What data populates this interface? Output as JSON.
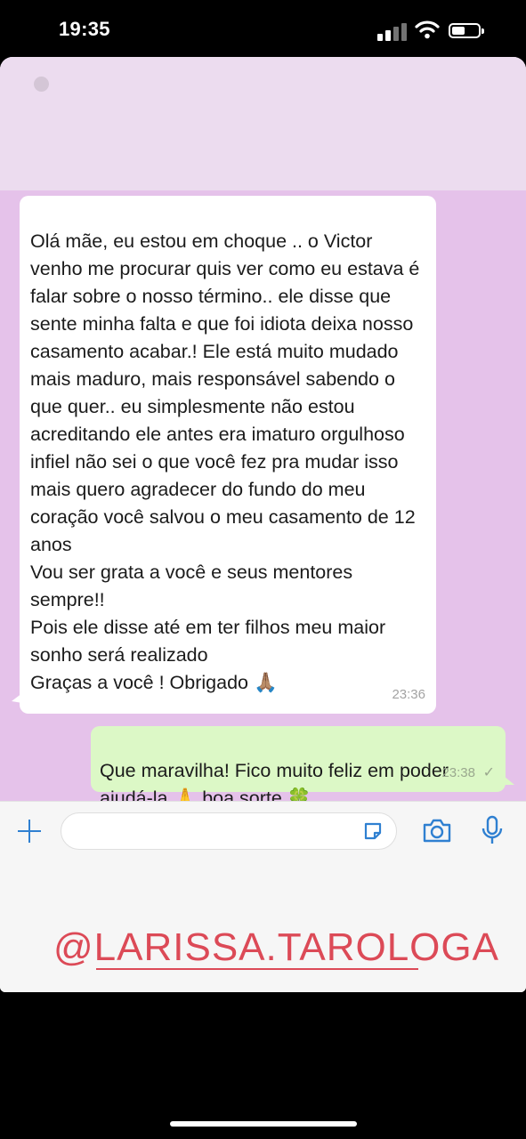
{
  "status_bar": {
    "time": "19:35",
    "icons": [
      "cellular-signal-icon",
      "wifi-icon",
      "battery-icon"
    ]
  },
  "chat": {
    "incoming_message": {
      "text": "Olá mãe, eu estou em choque .. o Victor venho me procurar quis ver como eu estava é falar sobre o nosso término.. ele disse que sente minha falta e que foi idiota deixa nosso casamento acabar.! Ele está muito mudado mais maduro, mais responsável sabendo o que quer.. eu simplesmente não estou acreditando ele antes era imaturo orgulhoso infiel não sei o que você fez pra mudar isso mais quero agradecer do fundo do meu coração você salvou o meu casamento de 12 anos\nVou ser grata a você e seus mentores sempre!!\nPois ele disse até em ter filhos meu maior sonho será realizado\nGraças a você ! Obrigado 🙏🏽",
      "time": "23:36"
    },
    "outgoing_message": {
      "text": "Que maravilha! Fico muito feliz em poder ajudá-la 🙏 boa sorte 🍀",
      "time": "23:38",
      "status": "✓"
    }
  },
  "input_bar": {
    "placeholder": "",
    "icons": [
      "plus-icon",
      "sticker-icon",
      "camera-icon",
      "mic-icon"
    ]
  },
  "watermark": {
    "handle": "@LARISSA.TAROLOGA"
  },
  "colors": {
    "chat_background": "#e5c2ea",
    "header_background": "#ecdcef",
    "outgoing_bubble": "#dcf8c6",
    "accent_blue": "#2f80d1",
    "watermark": "#dc4a57"
  }
}
